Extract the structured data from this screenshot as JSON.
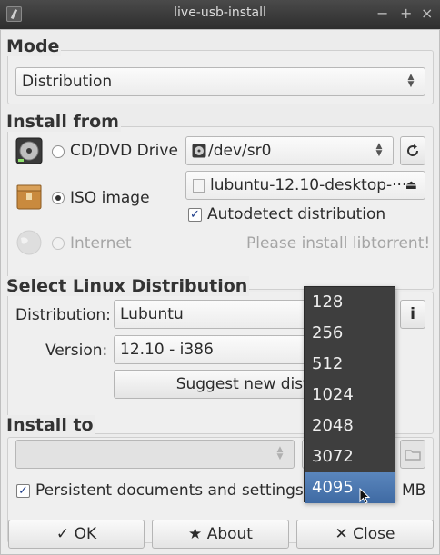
{
  "window": {
    "title": "live-usb-install",
    "controls": [
      "minimize",
      "maximize",
      "close"
    ]
  },
  "mode": {
    "group_title": "Mode",
    "combo_value": "Distribution"
  },
  "install_from": {
    "group_title": "Install from",
    "cd_label": "CD/DVD Drive",
    "cd_device": "/dev/sr0",
    "iso_label": "ISO image",
    "iso_file": "lubuntu-12.10-desktop-···",
    "autodetect_label": "Autodetect distribution",
    "autodetect_checked": true,
    "internet_label": "Internet",
    "internet_hint": "Please install libtorrent!",
    "selected_source": "iso"
  },
  "distribution": {
    "group_title": "Select Linux Distribution",
    "distribution_label": "Distribution:",
    "distribution_value": "Lubuntu",
    "version_label": "Version:",
    "version_value": "12.10 - i386",
    "suggest_button": "Suggest new distrib",
    "info_button": "i"
  },
  "install_to": {
    "group_title": "Install to",
    "persistent_label": "Persistent documents and settings",
    "persistent_checked": true,
    "unit": "MB"
  },
  "size_dropdown": {
    "options": [
      "128",
      "256",
      "512",
      "1024",
      "2048",
      "3072",
      "4095"
    ],
    "selected": "4095"
  },
  "footer": {
    "ok_label": "OK",
    "about_label": "About",
    "close_label": "Close"
  }
}
